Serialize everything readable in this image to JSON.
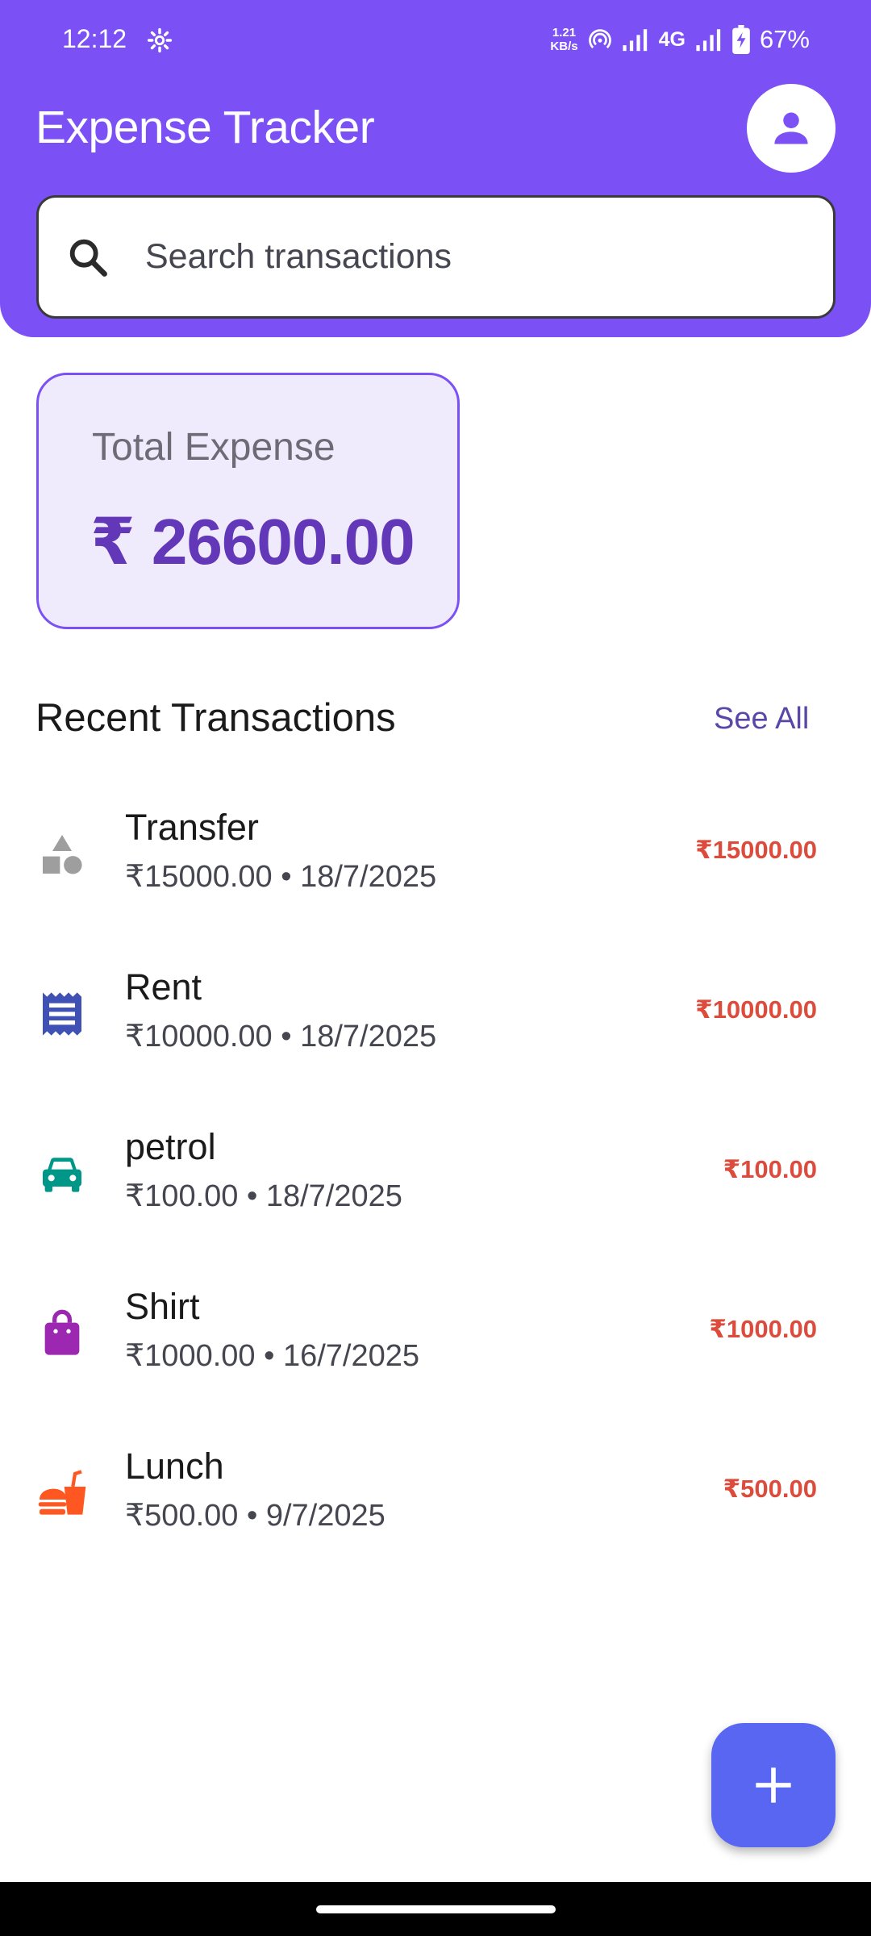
{
  "status_bar": {
    "time": "12:12",
    "net_speed_value": "1.21",
    "net_speed_unit": "KB/s",
    "network_type": "4G",
    "battery": "67%"
  },
  "header": {
    "title": "Expense Tracker",
    "avatar_icon": "person-icon"
  },
  "search": {
    "placeholder": "Search transactions",
    "icon": "search-icon"
  },
  "summary": {
    "label": "Total Expense",
    "value": "₹ 26600.00"
  },
  "recent": {
    "title": "Recent Transactions",
    "see_all_label": "See All"
  },
  "transactions": [
    {
      "name": "Transfer",
      "subtitle": "₹15000.00 • 18/7/2025",
      "amount": "₹15000.00",
      "icon": "category-shapes-icon",
      "icon_color": "#9e9e9e"
    },
    {
      "name": "Rent",
      "subtitle": "₹10000.00 • 18/7/2025",
      "amount": "₹10000.00",
      "icon": "receipt-icon",
      "icon_color": "#3f51b5"
    },
    {
      "name": "petrol",
      "subtitle": "₹100.00 • 18/7/2025",
      "amount": "₹100.00",
      "icon": "car-icon",
      "icon_color": "#009688"
    },
    {
      "name": "Shirt",
      "subtitle": "₹1000.00 • 16/7/2025",
      "amount": "₹1000.00",
      "icon": "shopping-bag-icon",
      "icon_color": "#9c27b0"
    },
    {
      "name": "Lunch",
      "subtitle": "₹500.00 • 9/7/2025",
      "amount": "₹500.00",
      "icon": "fastfood-icon",
      "icon_color": "#ff5722"
    }
  ],
  "fab": {
    "icon": "plus-icon"
  },
  "colors": {
    "primary": "#7b51f6",
    "card_background": "#f0ebfc",
    "total_value": "#6237b8",
    "expense_amount": "#dc4b3b",
    "fab": "#5866f2"
  }
}
